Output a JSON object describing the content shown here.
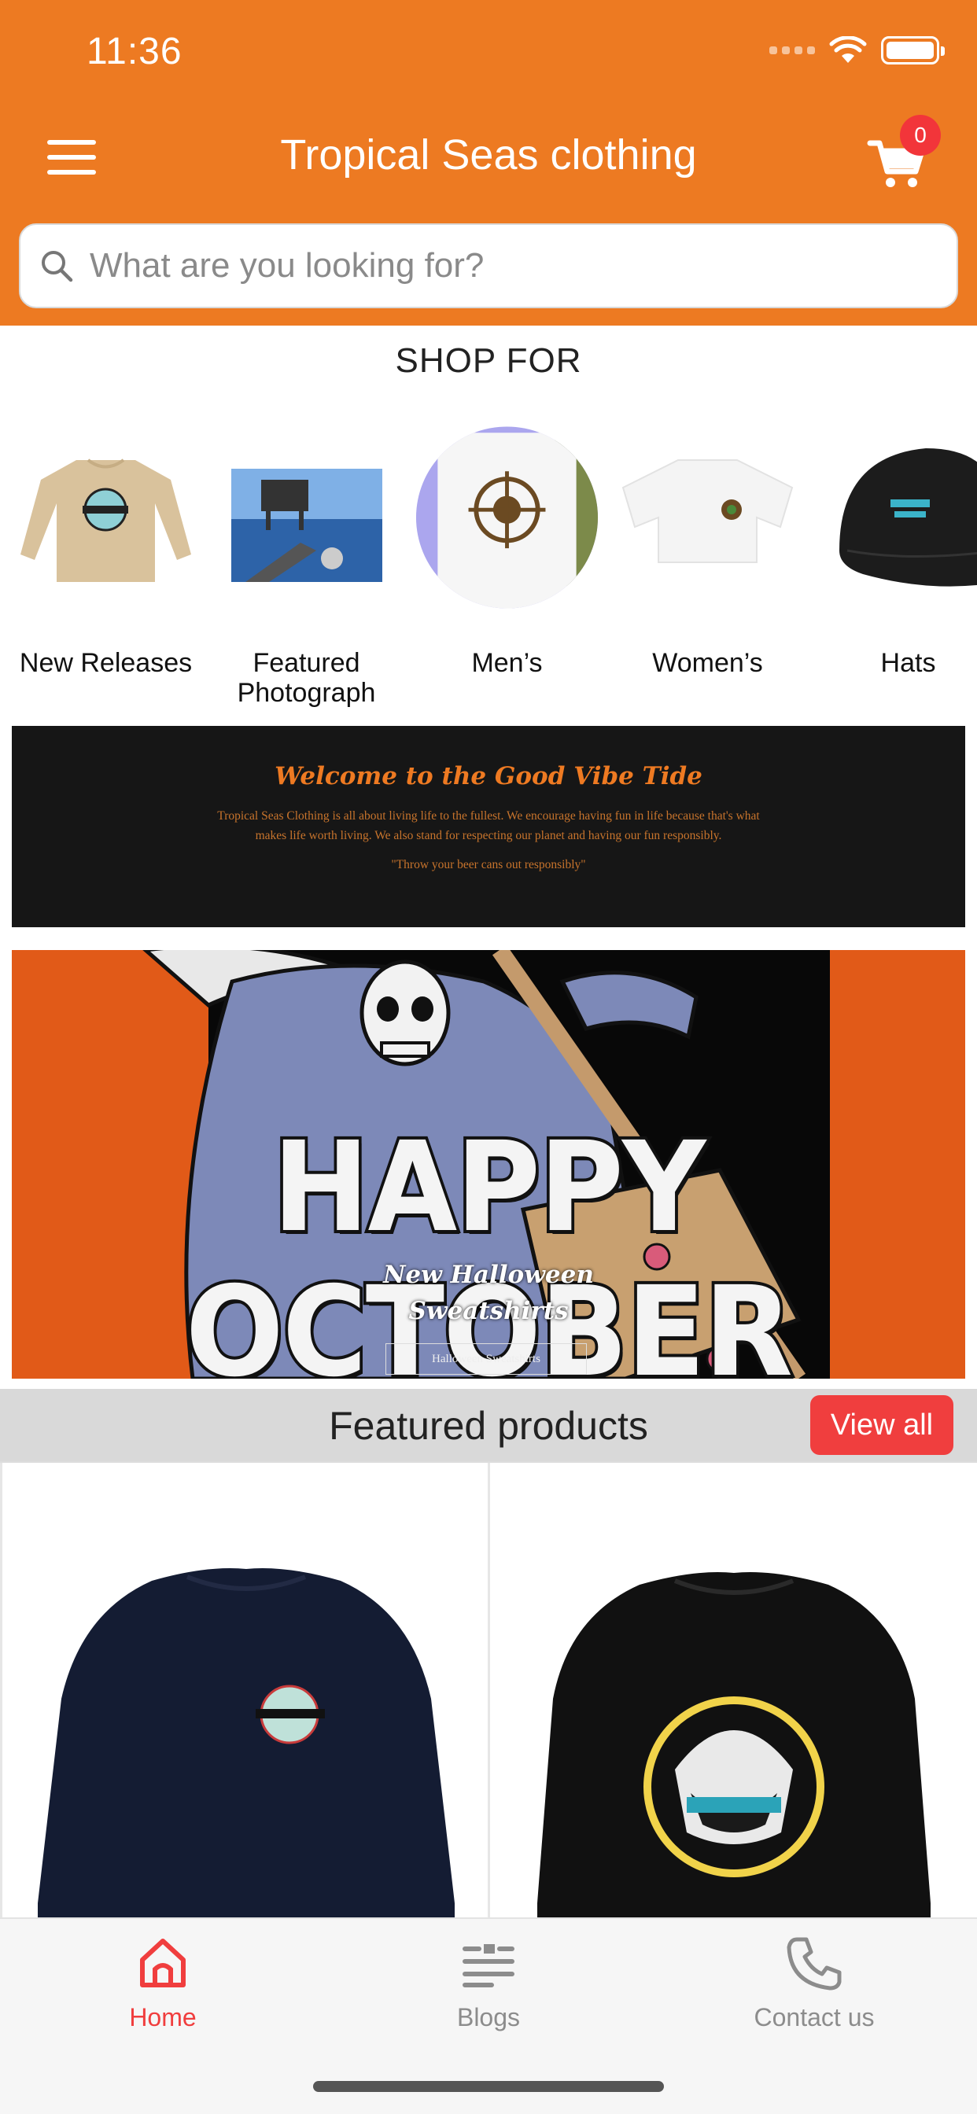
{
  "status_bar": {
    "time": "11:36"
  },
  "header": {
    "title": "Tropical Seas clothing",
    "cart_count": "0"
  },
  "search": {
    "placeholder": "What are you looking for?"
  },
  "shop_for": {
    "title": "SHOP FOR",
    "categories": [
      {
        "label": "New Releases"
      },
      {
        "label": "Featured Photograph"
      },
      {
        "label": "Men’s"
      },
      {
        "label": "Women’s"
      },
      {
        "label": "Hats"
      }
    ]
  },
  "welcome_banner": {
    "heading": "Welcome to the Good Vibe Tide",
    "body": "Tropical Seas Clothing is all about living life to the fullest. We encourage having fun in life because that's what makes life worth living. We also stand for respecting our planet and having our fun responsibly.",
    "quote": "\"Throw your beer cans out responsibly\""
  },
  "promo_banner": {
    "headline": "HAPPY OCTOBER",
    "subtitle_line1": "New Halloween",
    "subtitle_line2": "Sweatshirts",
    "button_label": "Halloween Sweatshirts"
  },
  "featured": {
    "title": "Featured products",
    "view_all_label": "View all"
  },
  "tab_bar": {
    "tabs": [
      {
        "label": "Home",
        "active": true
      },
      {
        "label": "Blogs",
        "active": false
      },
      {
        "label": "Contact us",
        "active": false
      }
    ]
  },
  "colors": {
    "brand_orange": "#ED7A22",
    "accent_red": "#F03E3E",
    "tab_inactive": "#8C8C8C"
  }
}
